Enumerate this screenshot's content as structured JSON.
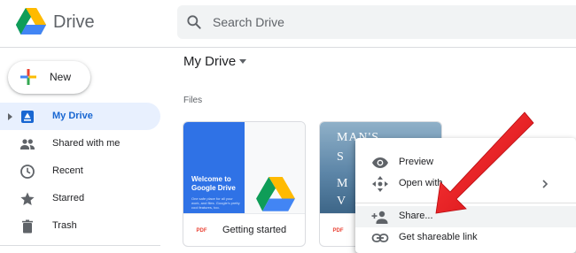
{
  "app": {
    "title": "Drive"
  },
  "search": {
    "placeholder": "Search Drive"
  },
  "new_button": {
    "label": "New"
  },
  "sidebar": {
    "items": [
      {
        "label": "My Drive",
        "icon": "my-drive-icon",
        "active": true
      },
      {
        "label": "Shared with me",
        "icon": "people-icon"
      },
      {
        "label": "Recent",
        "icon": "clock-icon"
      },
      {
        "label": "Starred",
        "icon": "star-icon"
      },
      {
        "label": "Trash",
        "icon": "trash-icon"
      }
    ]
  },
  "main": {
    "breadcrumb": "My Drive",
    "section_label": "Files",
    "files": [
      {
        "name": "Getting started",
        "type_badge": "PDF",
        "thumbnail": {
          "title": "Welcome to Google Drive",
          "subtitle": "One safe place for all your work, and files. Google's pretty cool features, too."
        }
      },
      {
        "name": "",
        "type_badge": "PDF",
        "thumbnail": {
          "cover_text_1": "MAN'S",
          "cover_text_2": "S",
          "cover_text_3": "M",
          "cover_text_4": "V"
        }
      }
    ]
  },
  "context_menu": {
    "items": [
      {
        "label": "Preview",
        "icon": "eye-icon"
      },
      {
        "label": "Open with",
        "icon": "move-icon",
        "has_submenu": true
      },
      {
        "label": "Share...",
        "icon": "add-person-icon",
        "highlighted": true
      },
      {
        "label": "Get shareable link",
        "icon": "link-icon"
      }
    ]
  },
  "colors": {
    "accent": "#1967d2",
    "active_bg": "#e8f0fe",
    "annotation_arrow": "#e8141b",
    "pdf_red": "#ea4335"
  }
}
